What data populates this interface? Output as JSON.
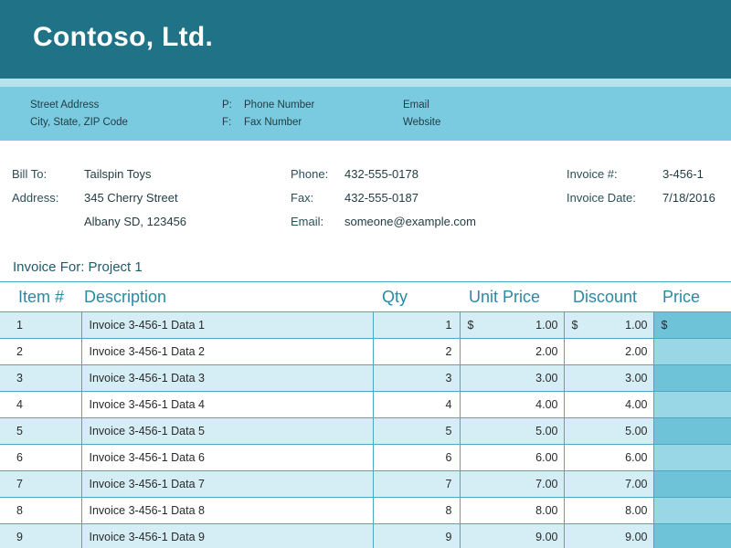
{
  "company": {
    "name": "Contoso, Ltd."
  },
  "contact": {
    "street": "Street Address",
    "city": "City, State, ZIP Code",
    "phone_prefix": "P:",
    "phone": "Phone Number",
    "fax_prefix": "F:",
    "fax": "Fax Number",
    "email": "Email",
    "website": "Website"
  },
  "bill_to": {
    "label": "Bill To:",
    "name": "Tailspin Toys",
    "address_label": "Address:",
    "address_line1": "345 Cherry Street",
    "address_line2": "Albany SD, 123456",
    "phone_label": "Phone:",
    "phone": "432-555-0178",
    "fax_label": "Fax:",
    "fax": "432-555-0187",
    "email_label": "Email:",
    "email": "someone@example.com"
  },
  "invoice": {
    "number_label": "Invoice #:",
    "number": "3-456-1",
    "date_label": "Invoice Date:",
    "date": "7/18/2016",
    "for_text": "Invoice For: Project 1"
  },
  "table": {
    "headers": {
      "item": "Item #",
      "description": "Description",
      "qty": "Qty",
      "unit_price": "Unit Price",
      "discount": "Discount",
      "price": "Price"
    },
    "currency": "$",
    "rows": [
      {
        "item": "1",
        "description": "Invoice 3-456-1 Data 1",
        "qty": "1",
        "unit_price": "1.00",
        "discount": "1.00",
        "price": ""
      },
      {
        "item": "2",
        "description": "Invoice 3-456-1 Data 2",
        "qty": "2",
        "unit_price": "2.00",
        "discount": "2.00",
        "price": ""
      },
      {
        "item": "3",
        "description": "Invoice 3-456-1 Data 3",
        "qty": "3",
        "unit_price": "3.00",
        "discount": "3.00",
        "price": ""
      },
      {
        "item": "4",
        "description": "Invoice 3-456-1 Data 4",
        "qty": "4",
        "unit_price": "4.00",
        "discount": "4.00",
        "price": ""
      },
      {
        "item": "5",
        "description": "Invoice 3-456-1 Data 5",
        "qty": "5",
        "unit_price": "5.00",
        "discount": "5.00",
        "price": ""
      },
      {
        "item": "6",
        "description": "Invoice 3-456-1 Data 6",
        "qty": "6",
        "unit_price": "6.00",
        "discount": "6.00",
        "price": ""
      },
      {
        "item": "7",
        "description": "Invoice 3-456-1 Data 7",
        "qty": "7",
        "unit_price": "7.00",
        "discount": "7.00",
        "price": ""
      },
      {
        "item": "8",
        "description": "Invoice 3-456-1 Data 8",
        "qty": "8",
        "unit_price": "8.00",
        "discount": "8.00",
        "price": ""
      },
      {
        "item": "9",
        "description": "Invoice 3-456-1 Data 9",
        "qty": "9",
        "unit_price": "9.00",
        "discount": "9.00",
        "price": ""
      }
    ]
  }
}
